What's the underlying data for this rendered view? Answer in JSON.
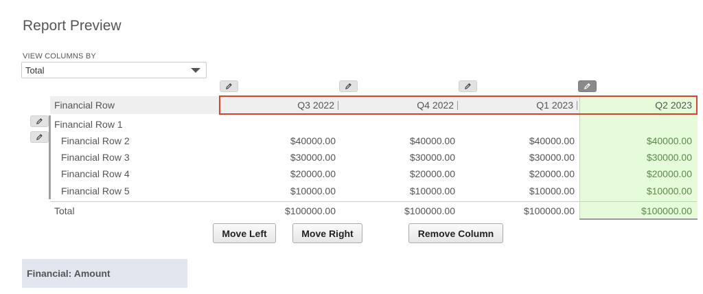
{
  "page": {
    "title": "Report Preview"
  },
  "view_columns": {
    "label": "VIEW COLUMNS BY",
    "selected": "Total"
  },
  "table": {
    "row_header": "Financial Row",
    "columns": [
      "Q3 2022",
      "Q4 2022",
      "Q1 2023",
      "Q2 2023"
    ],
    "group_row": "Financial Row 1",
    "rows": [
      {
        "label": "Financial Row 2",
        "values": [
          "$40000.00",
          "$40000.00",
          "$40000.00",
          "$40000.00"
        ]
      },
      {
        "label": "Financial Row 3",
        "values": [
          "$30000.00",
          "$30000.00",
          "$30000.00",
          "$30000.00"
        ]
      },
      {
        "label": "Financial Row 4",
        "values": [
          "$20000.00",
          "$20000.00",
          "$20000.00",
          "$20000.00"
        ]
      },
      {
        "label": "Financial Row 5",
        "values": [
          "$10000.00",
          "$10000.00",
          "$10000.00",
          "$10000.00"
        ]
      }
    ],
    "total": {
      "label": "Total",
      "values": [
        "$100000.00",
        "$100000.00",
        "$100000.00",
        "$100000.00"
      ]
    }
  },
  "actions": {
    "move_left": "Move Left",
    "move_right": "Move Right",
    "remove_column": "Remove Column"
  },
  "footer": {
    "label": "Financial: Amount"
  },
  "colors": {
    "selected_column_bg": "#e6fbd9",
    "highlight_border": "#d9412f",
    "footer_bg": "#e1e6ef"
  },
  "icons": {
    "edit": "pencil-icon"
  }
}
